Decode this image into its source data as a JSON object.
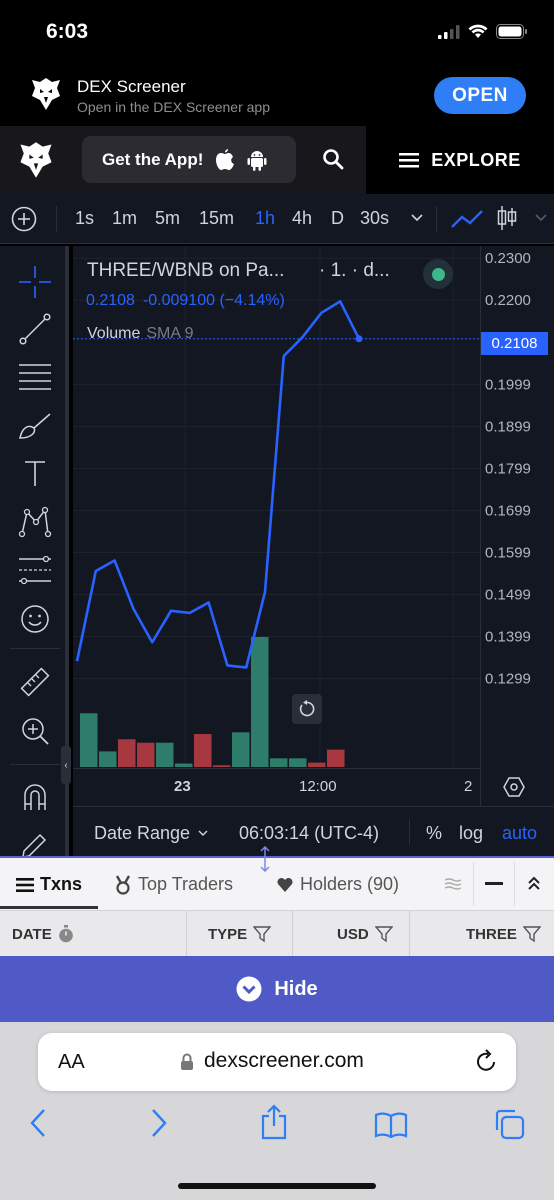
{
  "status": {
    "time": "6:03"
  },
  "banner": {
    "title": "DEX Screener",
    "subtitle": "Open in the DEX Screener app",
    "open_label": "OPEN"
  },
  "nav": {
    "get_app_label": "Get the App!",
    "explore_label": "EXPLORE"
  },
  "timeframes": [
    "1s",
    "1m",
    "5m",
    "15m",
    "1h",
    "4h",
    "D",
    "30s"
  ],
  "active_timeframe": "1h",
  "chart": {
    "pair_label": "THREE/WBNB on Pa...",
    "pair_suffix": "· 1. · d...",
    "price": "0.2108",
    "change": "-0.009100 (−4.14%)",
    "volume_label": "Volume",
    "sma_label": "SMA 9",
    "current_price_tag": "0.2108",
    "x_tick_labels": [
      "23",
      "12:00",
      "2"
    ],
    "bottom": {
      "date_range_label": "Date Range",
      "clock": "06:03:14 (UTC-4)",
      "percent": "%",
      "log": "log",
      "auto": "auto"
    }
  },
  "chart_data": {
    "type": "line",
    "title": "THREE/WBNB",
    "y_ticks": [
      "0.2300",
      "0.2200",
      "0.1999",
      "0.1899",
      "0.1799",
      "0.1699",
      "0.1599",
      "0.1499",
      "0.1399",
      "0.1299"
    ],
    "ylim": [
      0.12,
      0.231
    ],
    "x": [
      0,
      1,
      2,
      3,
      4,
      5,
      6,
      7,
      8,
      9,
      10,
      11,
      12,
      13,
      14,
      15
    ],
    "series": [
      {
        "values": [
          0.134,
          0.1555,
          0.158,
          0.1465,
          0.1385,
          0.146,
          0.1455,
          0.148,
          0.133,
          0.1325,
          0.1505,
          0.2067,
          0.2112,
          0.217,
          0.2197,
          0.2108
        ]
      }
    ],
    "volume": [
      {
        "value": 62,
        "up": true
      },
      {
        "value": 18,
        "up": true
      },
      {
        "value": 32,
        "up": false
      },
      {
        "value": 28,
        "up": false
      },
      {
        "value": 28,
        "up": true
      },
      {
        "value": 4,
        "up": true
      },
      {
        "value": 38,
        "up": false
      },
      {
        "value": 2,
        "up": false
      },
      {
        "value": 40,
        "up": true
      },
      {
        "value": 150,
        "up": true
      },
      {
        "value": 10,
        "up": true
      },
      {
        "value": 10,
        "up": true
      },
      {
        "value": 5,
        "up": false
      },
      {
        "value": 20,
        "up": false
      }
    ],
    "grid": true,
    "colors": {
      "line": "#2962ff",
      "up": "#2e7d6b",
      "down": "#a8383f"
    }
  },
  "tabs": [
    {
      "label": "Txns",
      "icon": "list-icon",
      "active": true
    },
    {
      "label": "Top Traders",
      "icon": "medal-icon",
      "active": false
    },
    {
      "label": "Holders (90)",
      "icon": "heart-icon",
      "active": false
    }
  ],
  "columns": [
    "DATE",
    "TYPE",
    "USD",
    "THREE"
  ],
  "hide_label": "Hide",
  "safari": {
    "aa": "AA",
    "url": "dexscreener.com"
  }
}
